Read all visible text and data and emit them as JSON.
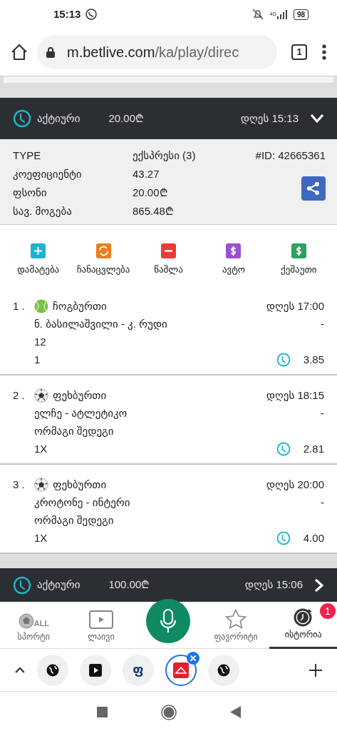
{
  "status_bar": {
    "time": "15:13",
    "network": "4G",
    "battery": "98"
  },
  "browser": {
    "host": "m.betlive.com",
    "path": "/ka/play/direc",
    "tab_count": "1"
  },
  "tickets": [
    {
      "status": "აქტიური",
      "amount": "20.00₾",
      "date": "დღეს 15:13",
      "expanded": true,
      "details": {
        "id": "#ID: 42665361",
        "rows": [
          {
            "label": "TYPE",
            "value": "ექსპრესი (3)"
          },
          {
            "label": "კოეფიციენტი",
            "value": "43.27"
          },
          {
            "label": "ფსონი",
            "value": "20.00₾"
          },
          {
            "label": "სავ. მოგება",
            "value": "865.48₾"
          }
        ]
      },
      "actions": [
        {
          "label": "დამატება",
          "kind": "add",
          "color": "#17b3cf"
        },
        {
          "label": "ჩანაცვლება",
          "kind": "replace",
          "color": "#ee7d1b"
        },
        {
          "label": "წაშლა",
          "kind": "remove",
          "color": "#ec3b36"
        },
        {
          "label": "ავტო",
          "kind": "auto",
          "color": "#9a4fd6"
        },
        {
          "label": "ქეშაუთი",
          "kind": "cashout",
          "color": "#2ea25a"
        }
      ],
      "bets": [
        {
          "number": "1 .",
          "kind": "tennis",
          "sport": "ჩოგბურთი",
          "date": "დღეს 17:00",
          "match": "ნ. ბასილაშვილი - კ. რუდი",
          "score": "-",
          "market": "12",
          "pick": "1",
          "odds": "3.85"
        },
        {
          "number": "2 .",
          "kind": "football",
          "sport": "ფეხბურთი",
          "date": "დღეს 18:15",
          "match": "ელჩე - ატლეტიკო",
          "score": "-",
          "market": "ორმაგი შედეგი",
          "pick": "1X",
          "odds": "2.81"
        },
        {
          "number": "3 .",
          "kind": "football",
          "sport": "ფეხბურთი",
          "date": "დღეს 20:00",
          "match": "კროტონე - ინტერი",
          "score": "-",
          "market": "ორმაგი შედეგი",
          "pick": "1X",
          "odds": "4.00"
        }
      ]
    },
    {
      "status": "აქტიური",
      "amount": "100.00₾",
      "date": "დღეს 15:06",
      "expanded": false
    }
  ],
  "bottom_nav": [
    {
      "kind": "sports",
      "label": "სპორტი",
      "icon_text": "ALL",
      "selected": false
    },
    {
      "kind": "live",
      "label": "ლაივი",
      "selected": false
    },
    {
      "kind": "voice",
      "selected": false
    },
    {
      "kind": "favorite",
      "label": "ფავორიტი",
      "selected": false
    },
    {
      "kind": "history",
      "label": "ისტორია",
      "badge": "1",
      "selected": true
    }
  ],
  "tab_strip": [
    {
      "kind": "globe",
      "selected": false
    },
    {
      "kind": "video",
      "selected": false
    },
    {
      "kind": "letter",
      "label": "ფ",
      "selected": false
    },
    {
      "kind": "site",
      "selected": true
    },
    {
      "kind": "globe",
      "selected": false
    }
  ]
}
